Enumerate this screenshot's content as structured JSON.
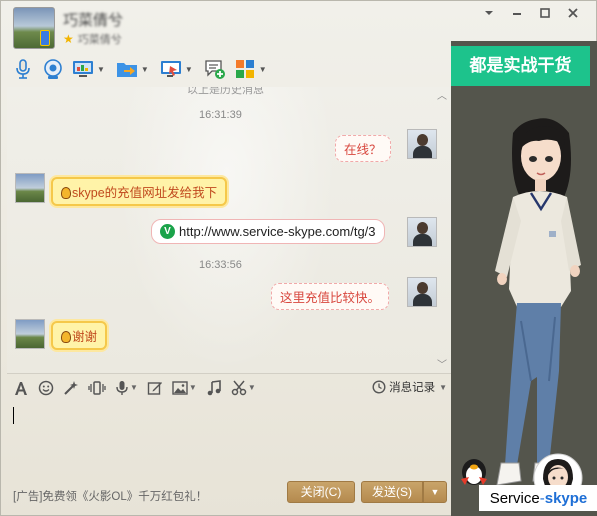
{
  "header": {
    "contact_name": "巧菜倩兮",
    "contact_sub": "巧菜倩兮"
  },
  "chat": {
    "clipped_top_text": "以上是历史消息",
    "messages": [
      {
        "type": "time",
        "text": "16:31:39"
      },
      {
        "type": "msg",
        "from": "me",
        "text": "在线？"
      },
      {
        "type": "msg",
        "from": "friend",
        "text": "skype的充值网址发给我下"
      },
      {
        "type": "msg",
        "from": "me",
        "text": "http://www.service-skype.com/tg/3"
      },
      {
        "type": "time",
        "text": "16:33:56"
      },
      {
        "type": "msg",
        "from": "me",
        "text": "这里充值比较快。"
      },
      {
        "type": "msg",
        "from": "friend",
        "text": "谢谢"
      }
    ]
  },
  "input_toolbar": {
    "history_label": "消息记录"
  },
  "bottom_bar": {
    "ad_text": "[广告]免费领《火影OL》千万红包礼！",
    "close_label": "关闭(C)",
    "send_label": "发送(S)"
  },
  "right_panel": {
    "promo_text": "都是实战干货",
    "brand_prefix": "Service",
    "brand_dash": "-",
    "brand_suffix": "skype"
  },
  "colors": {
    "accent_green": "#1dc38c",
    "button_tan": "#b48a4e",
    "panel_dark": "#54554c"
  },
  "icons": {
    "toolbar": [
      "microphone-icon",
      "video-call-icon",
      "screen-share-icon",
      "file-transfer-icon",
      "remote-desktop-icon",
      "group-chat-icon",
      "apps-icon"
    ],
    "input_toolbar": [
      "font-icon",
      "emoji-icon",
      "magic-icon",
      "shake-icon",
      "voice-icon",
      "edit-icon",
      "image-icon",
      "music-icon",
      "scissors-icon",
      "clock-icon"
    ]
  }
}
